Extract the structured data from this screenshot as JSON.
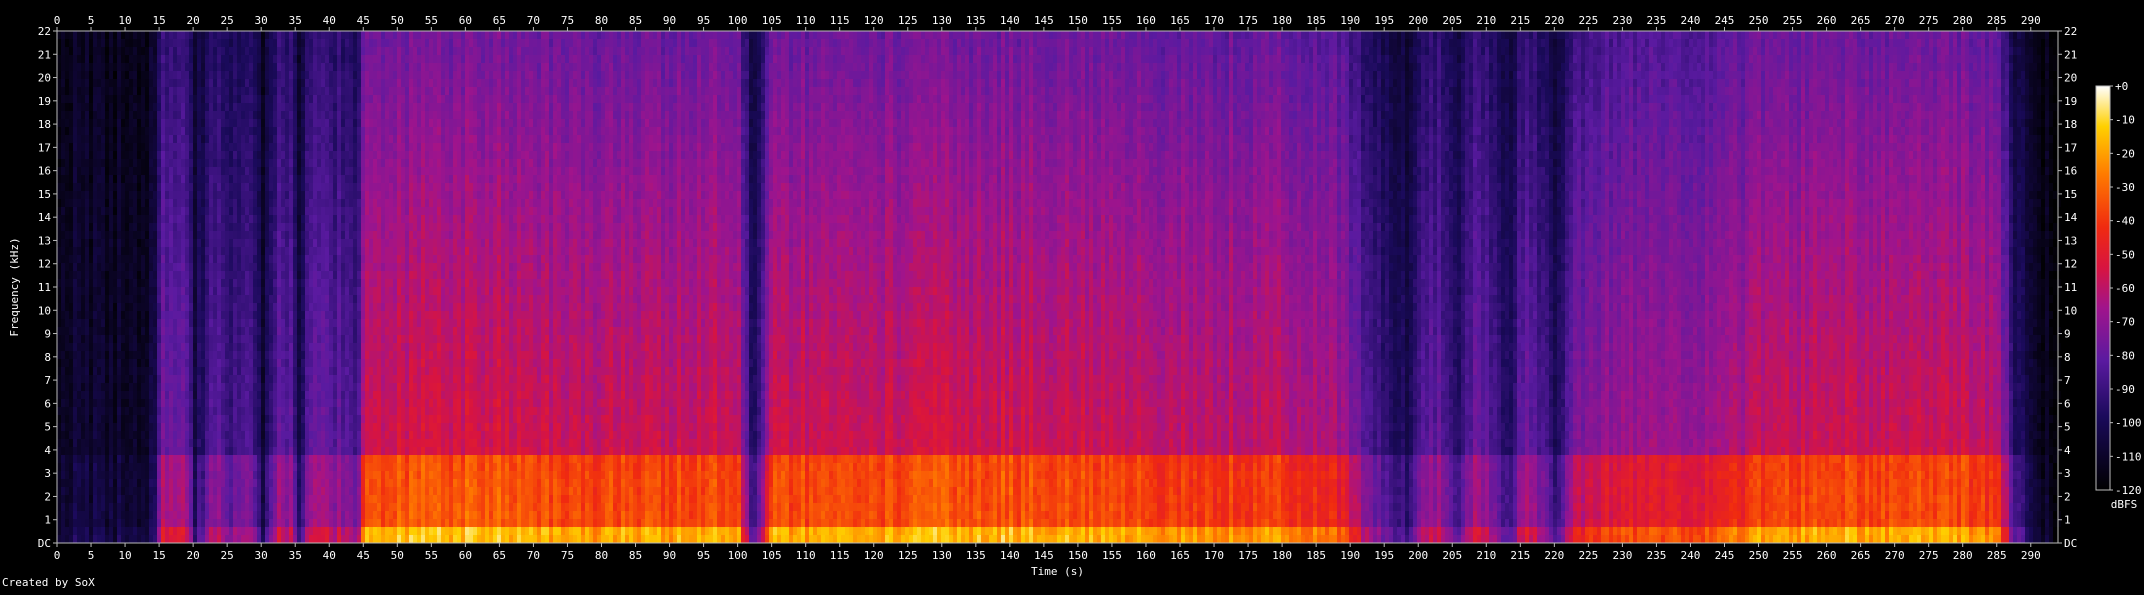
{
  "chart_data": {
    "type": "heatmap",
    "title": "",
    "xlabel": "Time (s)",
    "ylabel": "Frequency (kHz)",
    "xlim": [
      0,
      294
    ],
    "ylim": [
      0,
      22
    ],
    "x_ticks": [
      0,
      5,
      10,
      15,
      20,
      25,
      30,
      35,
      40,
      45,
      50,
      55,
      60,
      65,
      70,
      75,
      80,
      85,
      90,
      95,
      100,
      105,
      110,
      115,
      120,
      125,
      130,
      135,
      140,
      145,
      150,
      155,
      160,
      165,
      170,
      175,
      180,
      185,
      190,
      195,
      200,
      205,
      210,
      215,
      220,
      225,
      230,
      235,
      240,
      245,
      250,
      255,
      260,
      265,
      270,
      275,
      280,
      285,
      290
    ],
    "y_ticks": [
      "DC",
      "1",
      "2",
      "3",
      "4",
      "5",
      "6",
      "7",
      "8",
      "9",
      "10",
      "11",
      "12",
      "13",
      "14",
      "15",
      "16",
      "17",
      "18",
      "19",
      "20",
      "21",
      "22"
    ],
    "colorbar": {
      "label": "dBFS",
      "ticks": [
        "+0",
        "-10",
        "-20",
        "-30",
        "-40",
        "-50",
        "-60",
        "-70",
        "-80",
        "-90",
        "-100",
        "-110",
        "-120"
      ],
      "range": [
        -120,
        0
      ]
    },
    "intensity_profile": {
      "x": [
        0,
        5,
        10,
        14,
        15,
        17,
        19,
        20,
        22,
        24,
        25,
        26,
        28,
        30,
        32,
        34,
        35,
        37,
        39,
        41,
        43,
        44,
        45,
        50,
        60,
        70,
        75,
        80,
        90,
        100,
        101,
        102,
        103,
        105,
        110,
        120,
        130,
        140,
        150,
        160,
        162,
        170,
        180,
        186,
        188,
        190,
        193,
        195,
        198,
        200,
        203,
        205,
        208,
        210,
        213,
        215,
        218,
        220,
        222,
        225,
        230,
        235,
        240,
        245,
        250,
        260,
        270,
        280,
        285,
        287,
        290,
        294
      ],
      "level": [
        0.15,
        0.15,
        0.15,
        0.18,
        0.62,
        0.6,
        0.55,
        0.2,
        0.5,
        0.55,
        0.3,
        0.5,
        0.5,
        0.2,
        0.55,
        0.52,
        0.25,
        0.55,
        0.55,
        0.52,
        0.5,
        0.48,
        0.9,
        0.9,
        0.92,
        0.9,
        0.85,
        0.88,
        0.88,
        0.88,
        0.5,
        0.3,
        0.5,
        0.9,
        0.88,
        0.88,
        0.9,
        0.9,
        0.88,
        0.88,
        0.85,
        0.85,
        0.85,
        0.8,
        0.75,
        0.65,
        0.45,
        0.35,
        0.3,
        0.5,
        0.55,
        0.3,
        0.55,
        0.5,
        0.3,
        0.6,
        0.5,
        0.3,
        0.6,
        0.7,
        0.72,
        0.72,
        0.7,
        0.75,
        0.85,
        0.88,
        0.88,
        0.88,
        0.8,
        0.4,
        0.12,
        0.05
      ]
    }
  },
  "footer": {
    "credit": "Created by SoX"
  }
}
